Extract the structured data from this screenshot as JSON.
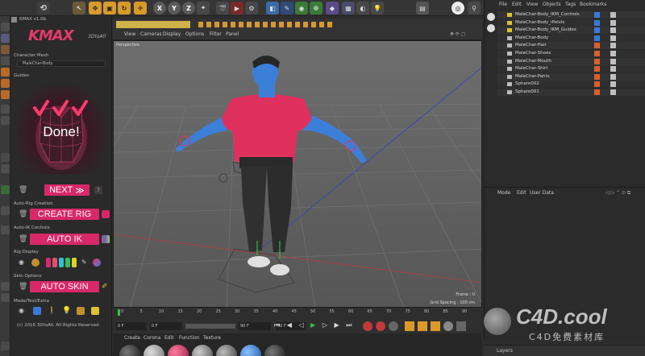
{
  "toolbar": {
    "xyz": [
      "X",
      "Y",
      "Z"
    ]
  },
  "kmax": {
    "version": "KMAX v1.0b",
    "logo_word": "KMAX",
    "logo_sub": "3DtoAll",
    "character_mesh_label": "Character Mesh",
    "character_mesh_value": "MaleChar-Body",
    "guides_label": "Guides",
    "done_text": "Done!",
    "next_label": "NEXT",
    "next_arrows": "≫",
    "help_label": "?",
    "auto_rig_label": "Auto-Rig Creation",
    "create_rig_label": "CREATE RIG",
    "auto_ik_label": "Auto-IK Controls",
    "auto_ik_button": "AUTO IK",
    "rig_display_label": "Rig Display",
    "skin_options_label": "Skin Options",
    "auto_skin_button": "AUTO SKIN",
    "mode_label": "Mode/Test/Extra",
    "copyright": "(c) 2016 3DtoAll. All Rights Reserved."
  },
  "viewport": {
    "menu": [
      "View",
      "Cameras",
      "Display",
      "Options",
      "Filter",
      "Panel"
    ],
    "camera_label": "Perspective",
    "frame_text": "Frame : 0",
    "grid_spacing_text": "Grid Spacing : 100 cm"
  },
  "timeline": {
    "ticks": [
      "0",
      "5",
      "10",
      "15",
      "20",
      "25",
      "30",
      "35",
      "40",
      "45",
      "50",
      "55",
      "60",
      "65",
      "70",
      "75",
      "80",
      "85",
      "90"
    ],
    "start_field": "0 F",
    "min_field": "0 F",
    "max_field": "90 F",
    "end_field": "90 F"
  },
  "material_menu": [
    "Create",
    "Corona",
    "Edit",
    "Function",
    "Texture"
  ],
  "objects_panel": {
    "menu": [
      "File",
      "Edit",
      "View",
      "Objects",
      "Tags",
      "Bookmarks"
    ],
    "rows": [
      {
        "name": "MaleChar-Body_IKM_Controls"
      },
      {
        "name": "MaleChar-Body_iPelvis"
      },
      {
        "name": "MaleChar-Body_IKM_Guides"
      },
      {
        "name": "MaleChar-Body"
      },
      {
        "name": "MaleChar-Hair"
      },
      {
        "name": "MaleChar-Shoes"
      },
      {
        "name": "MaleChar-Mouth"
      },
      {
        "name": "MaleChar-Shirt"
      },
      {
        "name": "MaleChar-Pants"
      },
      {
        "name": "Sphere002"
      },
      {
        "name": "Sphere001"
      }
    ]
  },
  "attributes_menu": [
    "Mode",
    "Edit",
    "User Data"
  ],
  "layers_label": "Layers",
  "watermark": {
    "main": "C4D.cool",
    "sub": "C4D免费素材库"
  },
  "colors": {
    "accent": "#d8286a",
    "shirt": "#e0305e",
    "skin": "#3b7fd8"
  }
}
